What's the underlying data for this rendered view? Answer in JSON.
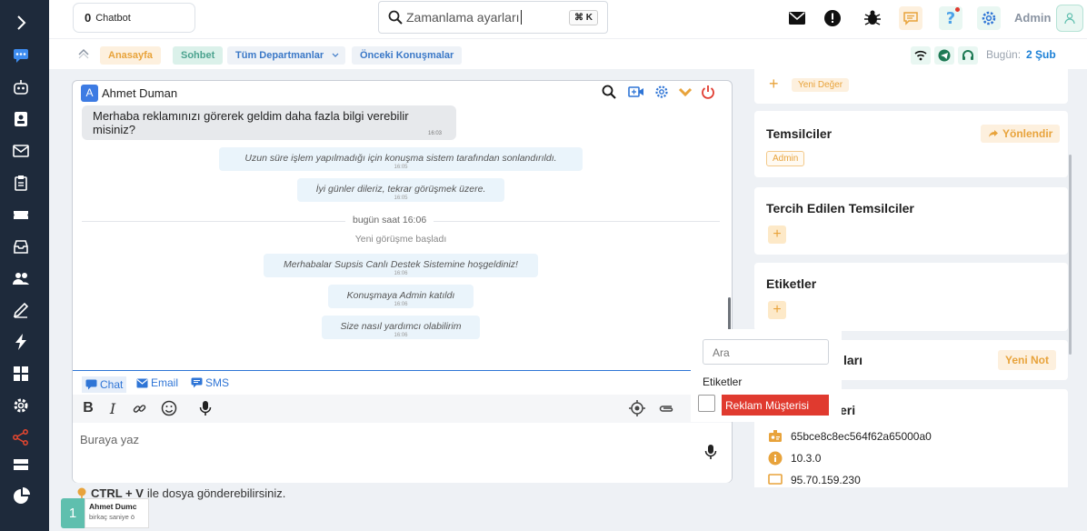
{
  "colors": {
    "sidebar_bg": "#1e2a3b",
    "accent_blue": "#2f75d6",
    "accent_orange": "#e8a33b",
    "danger_red": "#e03a2f"
  },
  "sidebar": {
    "items": [
      {
        "icon": "chevron-right-icon"
      },
      {
        "icon": "chat-icon"
      },
      {
        "icon": "robot-icon"
      },
      {
        "icon": "contact-card-icon"
      },
      {
        "icon": "mail-icon"
      },
      {
        "icon": "clipboard-icon"
      },
      {
        "icon": "ticket-icon"
      },
      {
        "icon": "inbox-icon"
      },
      {
        "icon": "users-icon"
      },
      {
        "icon": "edit-icon"
      },
      {
        "icon": "lightning-icon"
      },
      {
        "icon": "grid-icon"
      },
      {
        "icon": "settings-icon"
      },
      {
        "icon": "share-icon"
      },
      {
        "icon": "server-icon"
      },
      {
        "icon": "pie-chart-icon"
      }
    ]
  },
  "header": {
    "chatbot_count": "0",
    "chatbot_label": "Chatbot",
    "search_value": "Zamanlama ayarları",
    "search_shortcut": "⌘ K",
    "admin_label": "Admin"
  },
  "subnav": {
    "home": "Anasayfa",
    "chat": "Sohbet",
    "departments": "Tüm Departmanlar",
    "previous": "Önceki Konuşmalar",
    "today_label": "Bugün:",
    "today_value": "2 Şub"
  },
  "chat": {
    "contact_initial": "A",
    "contact_name": "Ahmet Duman",
    "incoming": {
      "text": "Merhaba reklamınızı görerek geldim daha fazla bilgi verebilir misiniz?",
      "time": "16:03"
    },
    "system1": {
      "text": "Uzun süre işlem yapılmadığı için konuşma sistem tarafından sonlandırıldı.",
      "time": "16:05"
    },
    "system2": {
      "text": "İyi günler dileriz, tekrar görüşmek üzere.",
      "time": "16:05"
    },
    "divider": "bugün saat 16:06",
    "new_conversation": "Yeni görüşme başladı",
    "system3": {
      "text": "Merhabalar Supsis Canlı Destek Sistemine hoşgeldiniz!",
      "time": "16:06"
    },
    "system4": {
      "text": "Konuşmaya Admin katıldı",
      "time": "16:06"
    },
    "system5": {
      "text": "Size nasıl yardımcı olabilirim",
      "time": "16:06"
    }
  },
  "compose": {
    "tab_chat": "Chat",
    "tab_email": "Email",
    "tab_sms": "SMS",
    "placeholder": "Buraya yaz"
  },
  "tag_dropdown": {
    "search_placeholder": "Ara",
    "title": "Etiketler",
    "tag": "Reklam Müşterisi"
  },
  "right": {
    "new_value": "Yeni Değer",
    "representatives_title": "Temsilciler",
    "redirect": "Yönlendir",
    "rep_badge": "Admin",
    "preferred_title": "Tercih Edilen Temsilciler",
    "tags_title": "Etiketler",
    "notes_title_partial": "ları",
    "new_note": "Yeni Not",
    "info_title_partial": "eri",
    "info_id": "65bce8c8ec564f62a65000a0",
    "info_version": "10.3.0",
    "info_ip": "95.70.159.230"
  },
  "footer": {
    "hint_keys": "CTRL + V",
    "hint_text": "ile dosya gönderebilirsiniz.",
    "user_number": "1",
    "user_name": "Ahmet Dumc",
    "user_status": "birkaç saniye ö"
  }
}
